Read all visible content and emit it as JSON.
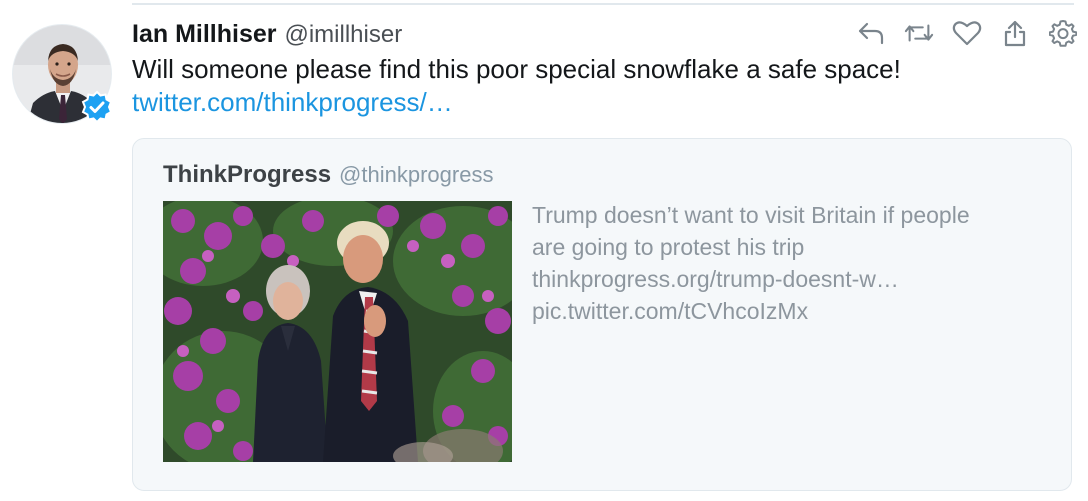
{
  "author": {
    "name": "Ian Millhiser",
    "handle": "@imillhiser",
    "verified": true,
    "avatar": "avatar-photo"
  },
  "tweet": {
    "text": "Will someone please find this poor special snowflake a safe space!",
    "link": "twitter.com/thinkprogress/…"
  },
  "actions": [
    {
      "name": "reply",
      "icon": "reply-icon"
    },
    {
      "name": "retweet",
      "icon": "retweet-icon"
    },
    {
      "name": "like",
      "icon": "heart-icon"
    },
    {
      "name": "share",
      "icon": "share-icon"
    },
    {
      "name": "settings",
      "icon": "gear-icon"
    }
  ],
  "quoted": {
    "name": "ThinkProgress",
    "handle": "@thinkprogress",
    "text_line1": "Trump doesn’t want to visit Britain if people",
    "text_line2": "are going to protest his trip",
    "url": "thinkprogress.org/trump-doesnt-w…",
    "pic": "pic.twitter.com/tCVhcoIzMx"
  },
  "colors": {
    "link": "#1b95e0",
    "verified": "#1da1f2",
    "muted_text": "#8d969e",
    "icon_gray": "#7a848c"
  }
}
